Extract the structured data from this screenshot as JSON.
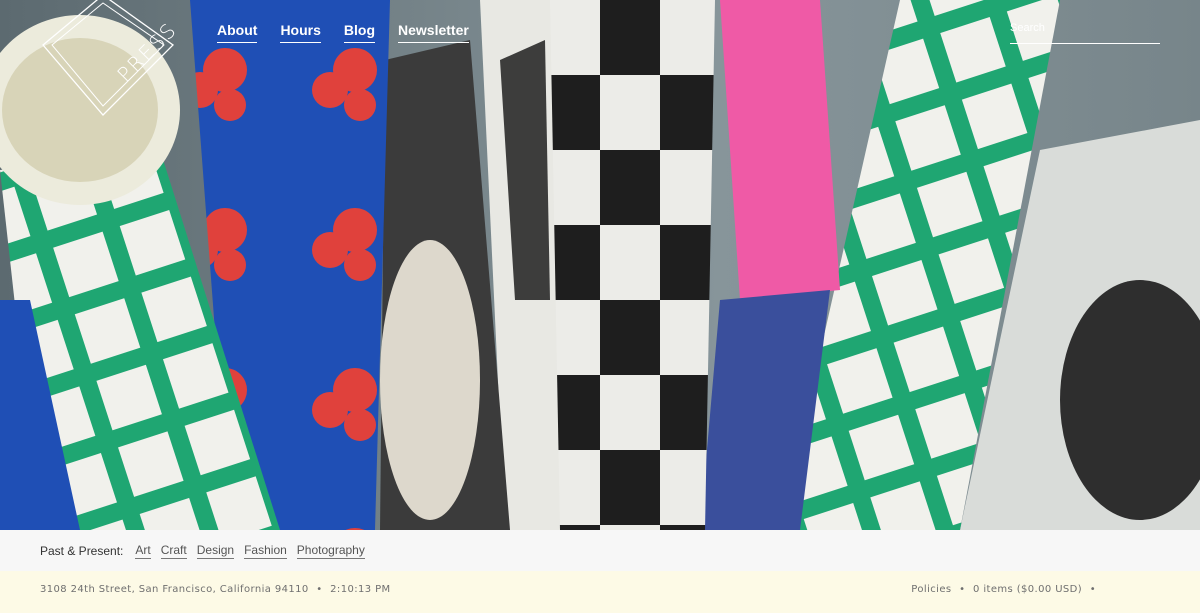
{
  "brand": {
    "logo_text": "PRESS"
  },
  "nav": {
    "items": [
      {
        "label": "About"
      },
      {
        "label": "Hours"
      },
      {
        "label": "Blog"
      },
      {
        "label": "Newsletter"
      }
    ]
  },
  "search": {
    "placeholder": "Search"
  },
  "categories": {
    "label": "Past & Present:",
    "items": [
      {
        "label": "Art"
      },
      {
        "label": "Craft"
      },
      {
        "label": "Design"
      },
      {
        "label": "Fashion"
      },
      {
        "label": "Photography"
      }
    ]
  },
  "footer": {
    "address": "3108 24th Street, San Francisco, California 94110",
    "time": "2:10:13 PM",
    "policies": "Policies",
    "cart": "0 items ($0.00 USD)",
    "separator": "•"
  },
  "colors": {
    "hero_blue": "#1f4fb5",
    "hero_green": "#1fa672",
    "hero_pink": "#ef5aa6",
    "hero_black": "#1e1e1e",
    "hero_gray": "#7d8a8f",
    "footer_bg": "#fdfae6",
    "category_bar_bg": "#f7f7f7"
  }
}
